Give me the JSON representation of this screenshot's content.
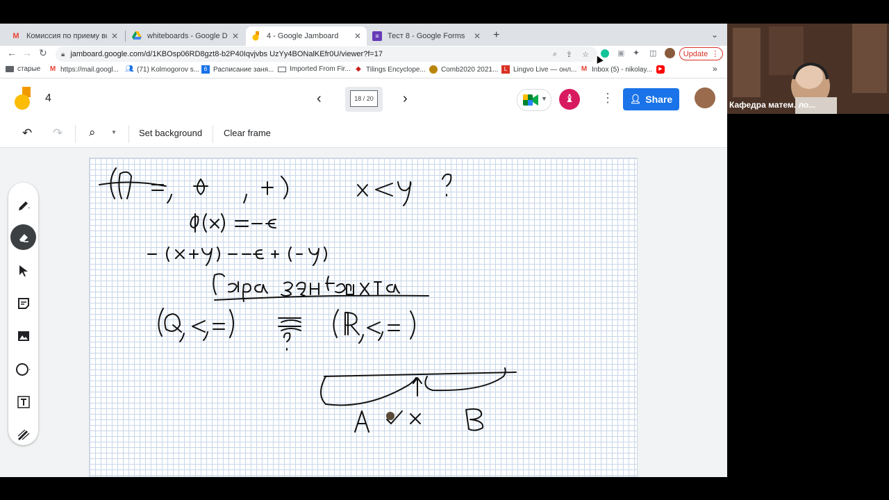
{
  "browser": {
    "tabs": [
      {
        "title": "Комиссия по приему вступит",
        "icon": "gmail-icon",
        "active": false
      },
      {
        "title": "whiteboards - Google Drive",
        "icon": "drive-icon",
        "active": false
      },
      {
        "title": "4 - Google Jamboard",
        "icon": "jamboard-icon",
        "active": true
      },
      {
        "title": "Тест 8 - Google Forms",
        "icon": "forms-icon",
        "active": false
      }
    ],
    "new_tab_label": "+",
    "url": "jamboard.google.com/d/1KBOsp06RD8gzt8-b2P40Iqvjvbs UzYy4BONalKEfr0U/viewer?f=17",
    "update_label": "Update",
    "bookmarks": [
      {
        "label": "старые",
        "icon": "folder-icon"
      },
      {
        "label": "https://mail.googl...",
        "icon": "gmail-icon"
      },
      {
        "label": "(71) Kolmogorov s...",
        "icon": "people-icon"
      },
      {
        "label": "Расписание заня...",
        "icon": "calendar-icon"
      },
      {
        "label": "Imported From Fir...",
        "icon": "folder-icon"
      },
      {
        "label": "Tilings Encyclope...",
        "icon": "tiling-icon"
      },
      {
        "label": "Comb2020 2021...",
        "icon": "comb-icon"
      },
      {
        "label": "Lingvo Live — онл...",
        "icon": "lingvo-icon"
      },
      {
        "label": "Inbox (5) - nikolay...",
        "icon": "gmail-icon"
      }
    ],
    "more_bookmarks": "»"
  },
  "jamboard": {
    "title": "4",
    "frame_counter": "18 / 20",
    "share_label": "Share",
    "toolbar": {
      "set_background": "Set background",
      "clear_frame": "Clear frame"
    },
    "tools": [
      "pen-icon",
      "eraser-icon",
      "select-icon",
      "sticky-note-icon",
      "image-icon",
      "circle-icon",
      "text-box-icon",
      "laser-icon"
    ],
    "colors": {
      "accent": "#1a73e8",
      "logo_yellow": "#fbbc04",
      "logo_orange": "#f29900"
    }
  },
  "video": {
    "participant_name": "Кафедра матем. ло..."
  }
}
